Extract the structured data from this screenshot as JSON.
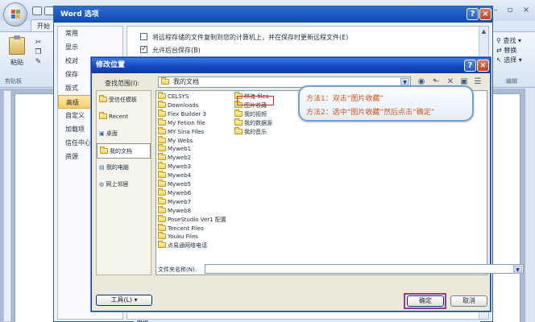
{
  "word": {
    "tab_home": "开始",
    "paste_label": "粘贴",
    "clipboard_group": "剪贴板",
    "edit_group": "编辑",
    "find_label": "查找 ▾",
    "replace_label": "替换",
    "select_label": "选择 ▾"
  },
  "options_dialog": {
    "title": "Word 选项",
    "nav": [
      "常用",
      "显示",
      "校对",
      "保存",
      "版式",
      "高级",
      "自定义",
      "加载项",
      "信任中心",
      "资源"
    ],
    "selected_nav": "高级",
    "options": [
      {
        "label": "将远程存储的文件复制到您的计算机上，并在保存时更新远程文件(E)",
        "checked": false
      },
      {
        "label": "允许后台保存(B)",
        "checked": true
      }
    ],
    "section_footer": "常规"
  },
  "modify_dialog": {
    "title": "修改位置",
    "look_in_label": "查找范围(I):",
    "look_in_value": "我的文档",
    "places": [
      "受信任模板",
      "Recent",
      "桌面",
      "我的文档",
      "我的电脑",
      "网上邻居"
    ],
    "selected_place": "我的文档",
    "files_col1": [
      "CELSYS",
      "Downloads",
      "Flex Builder 3",
      "My Fetion file",
      "MY Sina Files",
      "My Webs",
      "Myweb1",
      "Myweb2",
      "Myweb3",
      "Myweb4",
      "Myweb5",
      "Myweb6",
      "Myweb7",
      "Myweb8",
      "PoseStudio Ver1 配置",
      "Tencent Files",
      "Youku Files",
      "点易通网络电话"
    ],
    "files_col2": [
      "林海 files",
      "图片收藏",
      "我的视频",
      "我的数据源",
      "我的音乐"
    ],
    "file_name_label": "文件夹名称(N):",
    "file_name_value": "",
    "tools_label": "工具(L) ▾",
    "ok_label": "确定",
    "cancel_label": "取消"
  },
  "callout": {
    "line1": "方法1：双击“图片收藏”",
    "line2": "方法2：选中“图片收藏”然后点击“确定”"
  },
  "colors": {
    "titlebar_blue": "#0e45c0",
    "callout_text": "#d9540a",
    "highlight_red": "#e0302c",
    "ok_frame_purple": "#8b3ba4"
  }
}
